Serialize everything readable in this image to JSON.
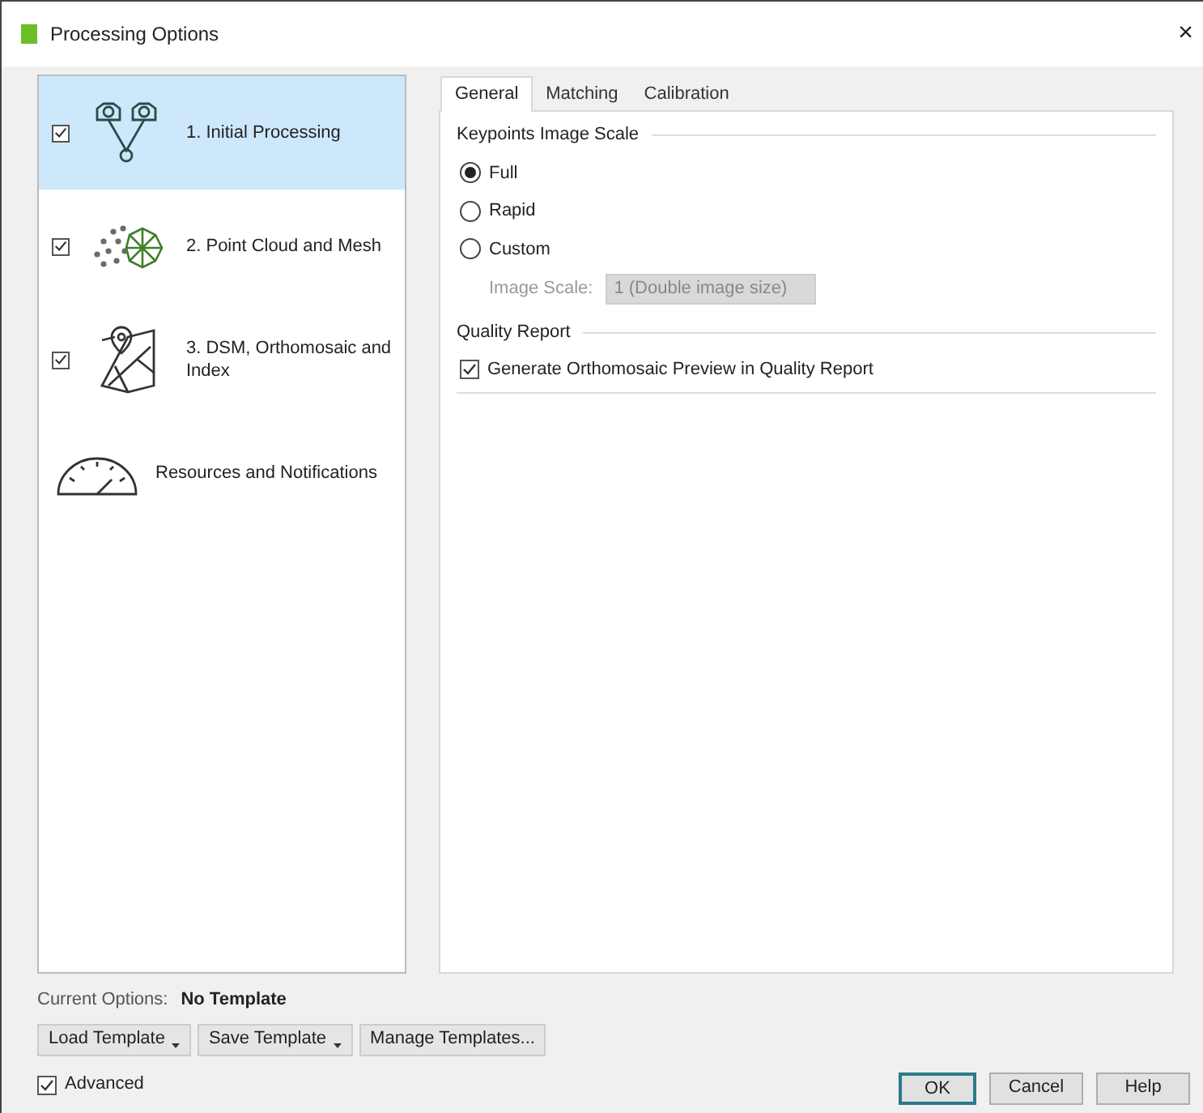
{
  "window": {
    "title": "Processing Options",
    "close": "×"
  },
  "steps": [
    {
      "kind": "initial",
      "label": "1. Initial Processing",
      "checked": true,
      "selected": true
    },
    {
      "kind": "cloud",
      "label": "2. Point Cloud and Mesh",
      "checked": true,
      "selected": false
    },
    {
      "kind": "dsm",
      "label": "3. DSM, Orthomosaic and Index",
      "checked": true,
      "selected": false
    },
    {
      "kind": "resources",
      "label": "Resources and Notifications",
      "selected": false
    }
  ],
  "tabs": [
    {
      "label": "General",
      "selected": true
    },
    {
      "label": "Matching",
      "selected": false
    },
    {
      "label": "Calibration",
      "selected": false
    }
  ],
  "keypoints": {
    "title": "Keypoints Image Scale",
    "options": [
      {
        "label": "Full",
        "selected": true
      },
      {
        "label": "Rapid",
        "selected": false
      },
      {
        "label": "Custom",
        "selected": false
      }
    ],
    "image_scale": {
      "label": "Image Scale:",
      "value": "1 (Double image size)",
      "disabled": true
    }
  },
  "quality_report": {
    "title": "Quality Report",
    "option": {
      "label": "Generate Orthomosaic Preview in Quality Report",
      "checked": true
    }
  },
  "current_options": {
    "label": "Current Options:",
    "value": "No Template"
  },
  "template_buttons": [
    {
      "label": "Load Template",
      "dropdown": true
    },
    {
      "label": "Save Template",
      "dropdown": true
    },
    {
      "label": "Manage Templates...",
      "dropdown": false
    }
  ],
  "advanced": {
    "label": "Advanced",
    "checked": true
  },
  "buttons": [
    {
      "label": "OK",
      "selected": true
    },
    {
      "label": "Cancel",
      "selected": false
    },
    {
      "label": "Help",
      "selected": false
    }
  ]
}
